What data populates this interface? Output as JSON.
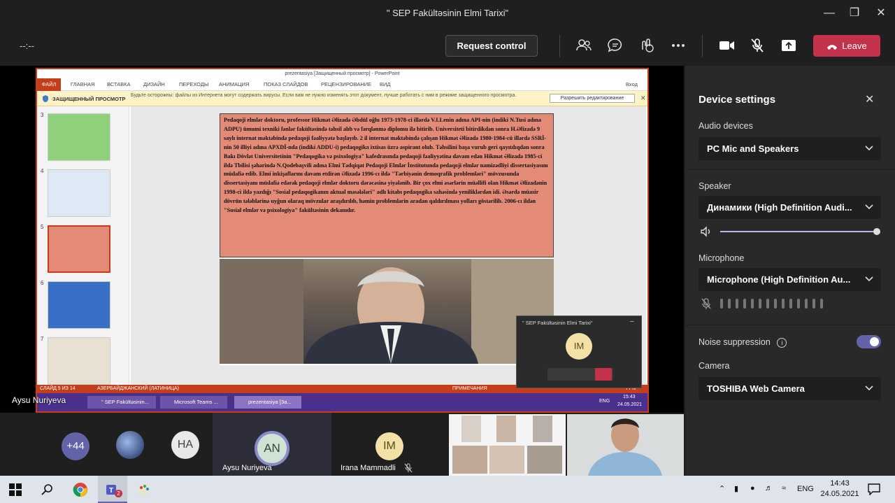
{
  "window": {
    "title": "\" SEP Fakültəsinin Elmi Tarixi\""
  },
  "toolbar": {
    "timer": "--:--",
    "request_control_label": "Request control",
    "leave_label": "Leave",
    "icons": [
      "people-icon",
      "chat-icon",
      "reactions-icon",
      "more-icon",
      "camera-icon",
      "mic-off-icon",
      "share-icon"
    ]
  },
  "ppt": {
    "title": "prezentasiya [Защищенный просмотр] - PowerPoint",
    "login": "Вход",
    "ribbon_tabs": [
      "ФАЙЛ",
      "ГЛАВНАЯ",
      "ВСТАВКА",
      "ДИЗАЙН",
      "ПЕРЕХОДЫ",
      "АНИМАЦИЯ",
      "ПОКАЗ СЛАЙДОВ",
      "РЕЦЕНЗИРОВАНИЕ",
      "ВИД"
    ],
    "warning_label": "ЗАЩИЩЕННЫЙ ПРОСМОТР",
    "warning_message": "Будьте осторожны: файлы из Интернета могут содержать вирусы. Если вам не нужно изменять этот документ, лучше работать с ним в режиме защищенного просмотра.",
    "enable_editing": "Разрешить редактирование",
    "slide_numbers": [
      "3",
      "4",
      "5",
      "6",
      "7"
    ],
    "slide_text": "Pedaqoji elmlər doktoru, professor Hikmət Əlizadə Əbdül oğlu 1973-1978-ci illərdə V.I.Lenin adına API-nin (indiki N.Tusi adına ADPU) ümumi texniki fənlər fakültəsində təhsil alıb və fərqlənmə diplomu ilə bitirib. Universiteti bitirdikdən sonra H.Əlizadə 9 saylı internat məktəbində pedaqoji fəaliyyətə başlayıb. 2 il internat məktəbində çalışan Hikmət Əlizadə 1980-1984-cü illərdə SSRİ-nin 50 illiyi adına APXDİ-nda (indiki ADDU-i) pedaqogika ixtisas üzrə aspirant olub. Təhsilini başa vurub geri qayıtdıqdan sonra Bakı Dövlət Universitetinin \"Pedaqogika və psixologiya\" kafedrasında pedaqoji fəaliyyətinə davam edən Hikmət Əlizadə 1985-ci ildə Tbilisi şəhərində N.Qodebaşvili adına Elmi Tədqiqat Pedaqoji Elmlər İnstitutunda pedaqoji elmlər namizədliyi dissertasiyasını müdafiə edib. Elmi inkişaflarını davam etdirən Əlizadə 1996-cı ildə \"Tərbiyənin demoqrafik problemləri\" mövzusunda dissertasiyanı müdafiə edərək pedaqoji elmlər doktoru dərəcəsinə yiyələnib. Bir çox elmi əsərlərin müəllifi olan Hikmət Əlizadənin 1998-ci ildə yazdığı \"Sosial pedaqogikanın aktual məsələləri\" adlı kitabı pedaqogika sahəsində yeniliklərdən idi. Əsərdə müasir dövrün tələblərinə uyğun olaraq mövzular araşdırılıb, həmin problemlərin aradan qaldırılması yolları göstərilib. 2006-cı ildən \"Sosial elmlər və psixologiya\" fakültəsinin dekanıdır.",
    "status_slide": "СЛАЙД 5 ИЗ 14",
    "status_lang": "АЗЕРБАЙДЖАНСКИЙ (ЛАТИНИЦА)",
    "status_notes": "ПРИМЕЧАНИЯ",
    "status_zoom": "77%",
    "taskbar": {
      "items": [
        "\" SEP Fakültəsinin...",
        "Microsoft Teams ...",
        "prezentasiya [За..."
      ],
      "lang": "ENG",
      "time": "15:43",
      "date": "24.05.2021"
    }
  },
  "presenter_name": "Aysu Nuriyeva",
  "pip": {
    "title": "\" SEP Fakültəsinin Elmi Tarixi\"",
    "avatar_initials": "IM"
  },
  "panel": {
    "title": "Device settings",
    "audio_devices_label": "Audio devices",
    "audio_device": "PC Mic and Speakers",
    "speaker_label": "Speaker",
    "speaker_device": "Динамики (High Definition Audi...",
    "speaker_volume": 1.0,
    "microphone_label": "Microphone",
    "microphone_device": "Microphone (High Definition Au...",
    "noise_suppression_label": "Noise suppression",
    "noise_suppression_on": true,
    "camera_label": "Camera",
    "camera_device": "TOSHIBA Web Camera"
  },
  "gallery": {
    "overflow_count": "+44",
    "ha_initials": "HA",
    "an_initials": "AN",
    "an_name": "Aysu Nuriyeva",
    "im_initials": "IM",
    "im_name": "Irana Mammadli"
  },
  "ostaskbar": {
    "lang": "ENG",
    "time": "14:43",
    "date": "24.05.2021",
    "teams_badge": "2"
  },
  "colors": {
    "accent": "#6264a7",
    "leave": "#c4314b",
    "ppt": "#c43e1c"
  }
}
